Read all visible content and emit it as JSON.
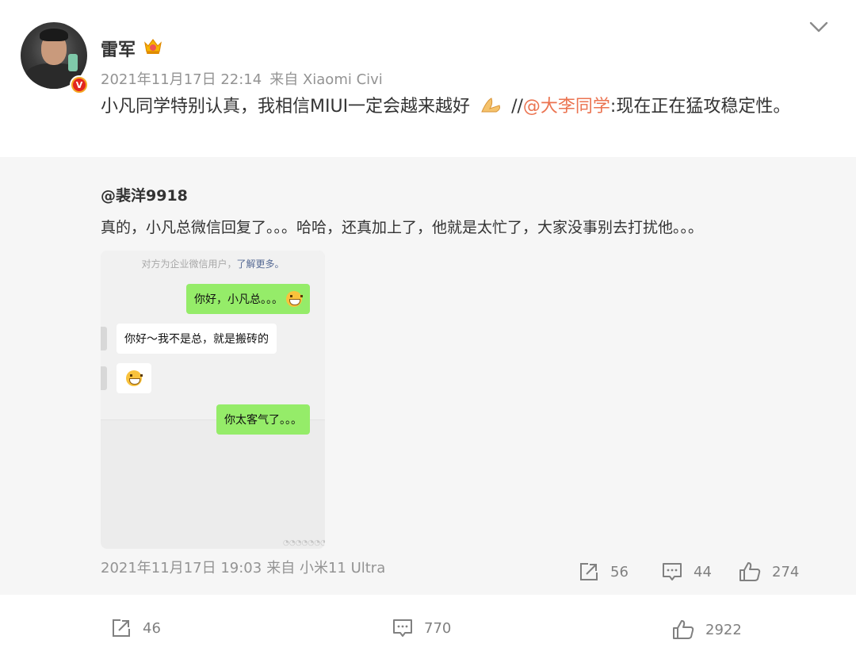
{
  "post": {
    "author": "雷军",
    "time": "2021年11月17日 22:14",
    "source": "来自 Xiaomi Civi",
    "text_before": "小凡同学特别认真，我相信MIUI一定会越来越好",
    "text_sep": "//",
    "mention": "@大李同学",
    "text_after": ":现在正在猛攻稳定性。"
  },
  "repost": {
    "original_author": "@裴洋9918",
    "text": "真的，小凡总微信回复了。。。哈哈，还真加上了，他就是太忙了，大家没事别去打扰他。。。",
    "time": "2021年11月17日 19:03",
    "source": "来自 小米11 Ultra",
    "stats": {
      "reposts": "56",
      "comments": "44",
      "likes": "274"
    },
    "chat": {
      "notice": "对方为企业微信用户，",
      "notice_link": "了解更多。",
      "messages": [
        {
          "side": "right",
          "text": "你好，小凡总。。。"
        },
        {
          "side": "left",
          "text": "你好～我不是总，就是搬砖的"
        },
        {
          "side": "left",
          "text": ""
        },
        {
          "side": "right",
          "text": "你太客气了。。。"
        }
      ]
    }
  },
  "actions": {
    "reposts": "46",
    "comments": "770",
    "likes": "2922"
  },
  "colors": {
    "mention": "#eb7350",
    "meta": "#939393",
    "repost_bg": "#f6f6f6",
    "wechat_green": "#95ec69"
  },
  "icons": [
    "chevron-down-icon",
    "crown-icon",
    "verified-v-icon",
    "pray-icon",
    "grin-icon",
    "share-icon",
    "comment-icon",
    "like-icon"
  ]
}
